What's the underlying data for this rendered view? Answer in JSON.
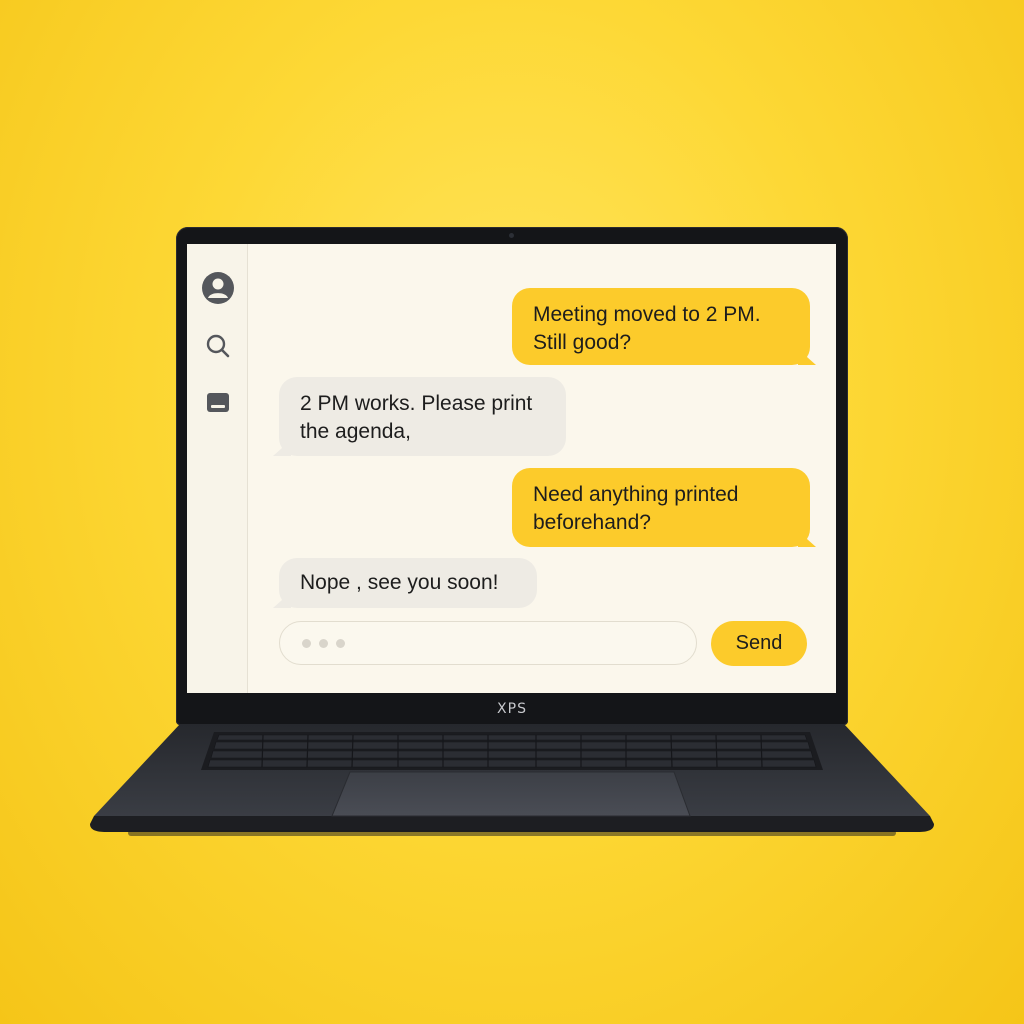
{
  "device": {
    "brand": "XPS"
  },
  "sidebar": {
    "items": [
      {
        "icon": "profile-icon"
      },
      {
        "icon": "search-icon"
      },
      {
        "icon": "inbox-icon"
      }
    ]
  },
  "conversation": {
    "messages": [
      {
        "direction": "outgoing",
        "text": "Meeting moved to 2 PM.\nStill good?"
      },
      {
        "direction": "incoming",
        "text": "2 PM works. Please print\nthe agenda,"
      },
      {
        "direction": "outgoing",
        "text": "Need anything printed\nbeforehand?"
      },
      {
        "direction": "incoming",
        "text": "Nope , see you soon!"
      }
    ]
  },
  "composer": {
    "placeholder": "• • •",
    "send_label": "Send"
  },
  "colors": {
    "background": "#FDD835",
    "outgoing_bubble": "#FCCB2B",
    "incoming_bubble": "#EEEBE4",
    "screen": "#FBF7EC"
  }
}
